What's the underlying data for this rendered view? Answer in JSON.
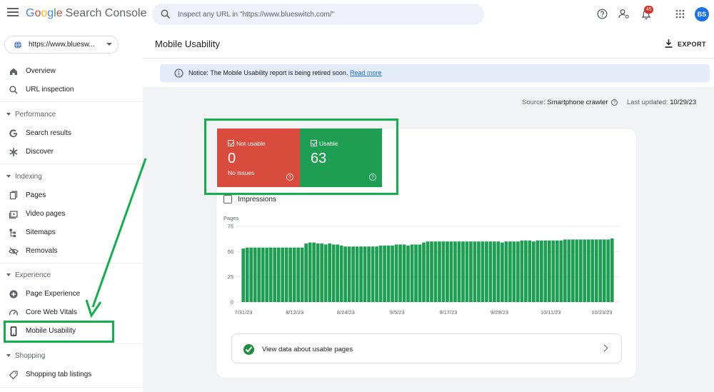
{
  "app": {
    "logo_letters": [
      "G",
      "o",
      "o",
      "g",
      "l",
      "e"
    ],
    "product": "Search Console",
    "search_placeholder": "Inspect any URL in \"https://www.blueswitch.com/\"",
    "notifications_count": "45",
    "avatar_initials": "BS",
    "icons": [
      "menu-icon",
      "search-icon",
      "help-icon",
      "accounts-icon",
      "bell-icon",
      "apps-icon"
    ]
  },
  "sidebar": {
    "property_url": "https://www.bluesw...",
    "items": [
      {
        "label": "Overview",
        "icon": "home-icon"
      },
      {
        "label": "URL inspection",
        "icon": "search-icon"
      }
    ],
    "sections": [
      {
        "title": "Performance",
        "items": [
          {
            "label": "Search results",
            "icon": "google-g-icon"
          },
          {
            "label": "Discover",
            "icon": "asterisk-icon"
          }
        ]
      },
      {
        "title": "Indexing",
        "items": [
          {
            "label": "Pages",
            "icon": "pages-icon"
          },
          {
            "label": "Video pages",
            "icon": "video-pages-icon"
          },
          {
            "label": "Sitemaps",
            "icon": "sitemap-icon"
          },
          {
            "label": "Removals",
            "icon": "removals-icon"
          }
        ]
      },
      {
        "title": "Experience",
        "items": [
          {
            "label": "Page Experience",
            "icon": "page-experience-icon"
          },
          {
            "label": "Core Web Vitals",
            "icon": "gauge-icon"
          },
          {
            "label": "Mobile Usability",
            "icon": "phone-icon",
            "active": true
          }
        ]
      },
      {
        "title": "Shopping",
        "items": [
          {
            "label": "Shopping tab listings",
            "icon": "tag-icon"
          }
        ]
      }
    ]
  },
  "main": {
    "title": "Mobile Usability",
    "export_label": "EXPORT",
    "notice_text": "Notice: The Mobile Usability report is being retired soon.",
    "notice_link": "Read more",
    "source_label": "Source:",
    "source_value": "Smartphone crawler",
    "updated_label": "Last updated:",
    "updated_value": "10/29/23",
    "tiles": {
      "not_usable": {
        "label": "Not usable",
        "value": "0",
        "sub": "No issues",
        "color": "#d94b3c"
      },
      "usable": {
        "label": "Usable",
        "value": "63",
        "color": "#1e9e52"
      }
    },
    "impressions_label": "Impressions",
    "view_data_label": "View data about usable pages"
  },
  "chart_data": {
    "type": "bar",
    "ylabel": "Pages",
    "ylim": [
      0,
      75
    ],
    "yticks": [
      0,
      25,
      50,
      75
    ],
    "color": "#1e9e52",
    "xtick_labels": [
      "7/31/23",
      "8/12/23",
      "8/24/23",
      "9/5/23",
      "9/17/23",
      "9/29/23",
      "10/11/23",
      "10/23/23"
    ],
    "values": [
      53,
      54,
      54,
      54,
      54,
      54,
      54,
      54,
      54,
      54,
      54,
      54,
      54,
      54,
      54,
      54,
      58,
      59,
      59,
      58,
      58,
      57,
      58,
      57,
      57,
      56,
      55,
      55,
      55,
      55,
      55,
      55,
      55,
      55,
      55,
      56,
      56,
      56,
      56,
      57,
      57,
      57,
      56,
      57,
      57,
      57,
      59,
      60,
      60,
      60,
      60,
      60,
      60,
      60,
      60,
      60,
      60,
      60,
      60,
      60,
      60,
      60,
      60,
      60,
      60,
      60,
      59,
      60,
      60,
      60,
      60,
      61,
      61,
      61,
      60,
      61,
      61,
      61,
      61,
      61,
      61,
      61,
      62,
      62,
      62,
      62,
      62,
      62,
      62,
      62,
      62,
      62,
      62,
      62,
      63
    ]
  }
}
